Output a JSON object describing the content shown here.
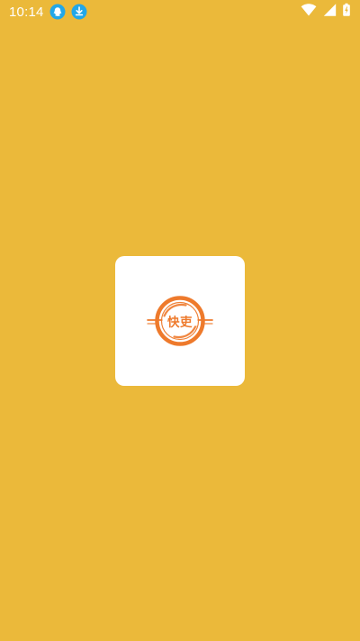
{
  "status_bar": {
    "time": "10:14",
    "notification_icons": [
      "qq-icon",
      "download-icon"
    ],
    "system_icons": [
      "wifi-icon",
      "cellular-signal-icon",
      "battery-charging-icon"
    ],
    "accent_download": "#22A7E8",
    "accent_qq": "#22A7E8"
  },
  "splash": {
    "background_color": "#EBB93A",
    "card_color": "#FFFFFF",
    "logo": {
      "text": "快吏",
      "color": "#EE7A2C",
      "icon_name": "app-logo"
    }
  }
}
